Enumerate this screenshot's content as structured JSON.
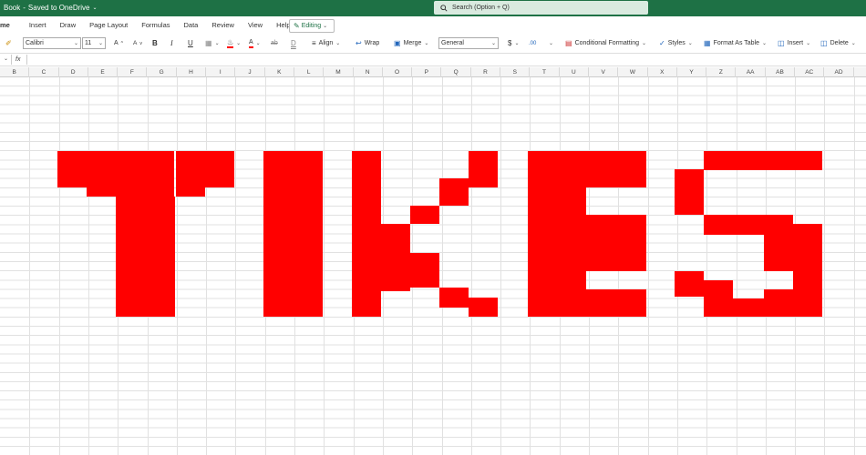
{
  "titlebar": {
    "doc_title": "Book",
    "save_status": "Saved to OneDrive",
    "search_placeholder": "Search (Option + Q)"
  },
  "tabs": [
    "me",
    "Insert",
    "Draw",
    "Page Layout",
    "Formulas",
    "Data",
    "Review",
    "View",
    "Help"
  ],
  "editing_label": "Editing",
  "toolbar": {
    "font_name": "Calibri",
    "font_size": "11",
    "bold": "B",
    "italic": "I",
    "underline": "U",
    "strike": "ab",
    "double_underline": "D",
    "grow_font": "A",
    "shrink_font": "A",
    "font_color": "A",
    "align_label": "Align",
    "wrap_label": "Wrap",
    "merge_label": "Merge",
    "number_format": "General",
    "currency": "$",
    "cond_format_label": "Conditional Formatting",
    "styles_label": "Styles",
    "format_table_label": "Format As Table",
    "insert_label": "Insert",
    "delete_label": "Delete"
  },
  "formula_bar": {
    "fx": "fx",
    "value": ""
  },
  "columns": [
    "B",
    "C",
    "D",
    "E",
    "F",
    "G",
    "H",
    "I",
    "J",
    "K",
    "L",
    "M",
    "N",
    "O",
    "P",
    "Q",
    "R",
    "S",
    "T",
    "U",
    "V",
    "W",
    "X",
    "Y",
    "Z",
    "AA",
    "AB",
    "AC",
    "AD"
  ],
  "colors": {
    "titlebar": "#1e7145",
    "fill_red": "#ff0000"
  }
}
